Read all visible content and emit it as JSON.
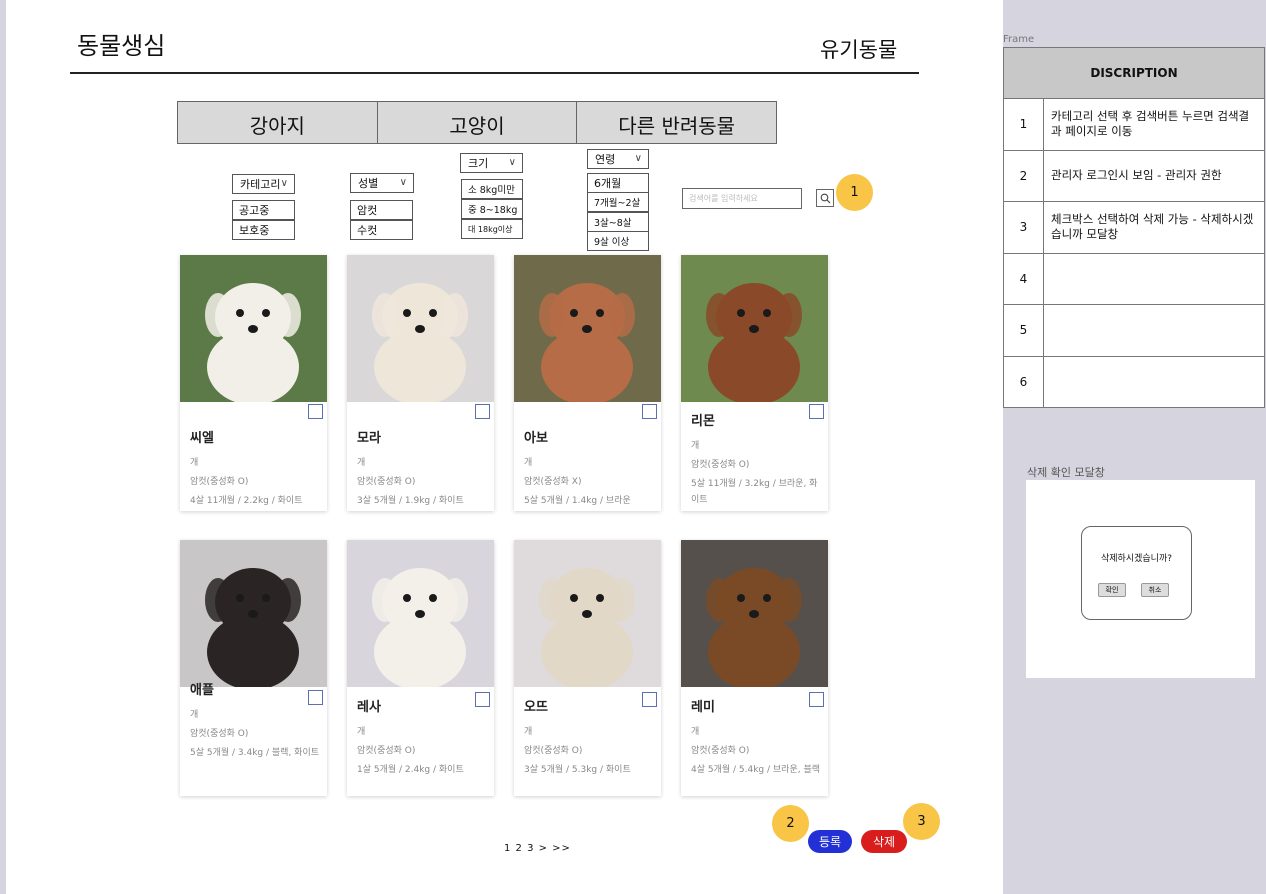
{
  "header": {
    "site_title": "동물생심",
    "page_title": "유기동물"
  },
  "tabs": [
    "강아지",
    "고양이",
    "다른 반려동물"
  ],
  "filters": {
    "category": {
      "label": "카테고리",
      "options": [
        "공고중",
        "보호중"
      ]
    },
    "sex": {
      "label": "성별",
      "options": [
        "암컷",
        "수컷"
      ]
    },
    "size": {
      "label": "크기",
      "options": [
        "소 8kg미만",
        "중 8~18kg",
        "대 18kg이상"
      ]
    },
    "age": {
      "label": "연령",
      "options": [
        "6개월",
        "7개월~2살",
        "3살~8살",
        "9살 이상"
      ]
    }
  },
  "search": {
    "placeholder": "검색어를 입력하세요"
  },
  "badges": [
    "1",
    "2",
    "3"
  ],
  "cards": [
    {
      "name": "씨엘",
      "species": "개",
      "sex": "암컷(중성화 O)",
      "detail": "4살 11개월 / 2.2kg / 화이트",
      "fur": "#f2efe8",
      "bg": "#5b7a47"
    },
    {
      "name": "모라",
      "species": "개",
      "sex": "암컷(중성화 O)",
      "detail": "3살 5개월 / 1.9kg / 화이트",
      "fur": "#efe6da",
      "bg": "#dad7d9"
    },
    {
      "name": "아보",
      "species": "개",
      "sex": "암컷(중성화 X)",
      "detail": "5살 5개월 / 1.4kg / 브라운",
      "fur": "#b56c47",
      "bg": "#6f6a4a"
    },
    {
      "name": "리몬",
      "species": "개",
      "sex": "암컷(중성화 O)",
      "detail": "5살 11개월 / 3.2kg / 브라운, 화이트",
      "fur": "#8a4a2a",
      "bg": "#6e8a4e"
    },
    {
      "name": "애플",
      "species": "개",
      "sex": "암컷(중성화 O)",
      "detail": "5살 5개월 / 3.4kg / 블랙, 화이트",
      "fur": "#2a2424",
      "bg": "#c9c6c8"
    },
    {
      "name": "레사",
      "species": "개",
      "sex": "암컷(중성화 O)",
      "detail": "1살 5개월 / 2.4kg / 화이트",
      "fur": "#f3efe9",
      "bg": "#d8d6dc"
    },
    {
      "name": "오뜨",
      "species": "개",
      "sex": "암컷(중성화 O)",
      "detail": "3살 5개월 / 5.3kg / 화이트",
      "fur": "#e2d8c8",
      "bg": "#dfdbdc"
    },
    {
      "name": "레미",
      "species": "개",
      "sex": "암컷(중성화 O)",
      "detail": "4살 5개월 / 5.4kg / 브라운, 블랙",
      "fur": "#7a4a26",
      "bg": "#55504c"
    }
  ],
  "pager": {
    "text": "1 2 3 > >>"
  },
  "actions": {
    "register": "등록",
    "delete": "삭제"
  },
  "description": {
    "frame_label": "Frame",
    "header": "DISCRIPTION",
    "rows": [
      {
        "num": "1",
        "text": "카테고리 선택 후 검색버튼 누르면 검색결과 페이지로 이동"
      },
      {
        "num": "2",
        "text": "관리자 로그인시 보임 - 관리자 권한"
      },
      {
        "num": "3",
        "text": "체크박스 선택하여 삭제 가능 - 삭제하시겠습니까 모달창"
      },
      {
        "num": "4",
        "text": ""
      },
      {
        "num": "5",
        "text": ""
      },
      {
        "num": "6",
        "text": ""
      }
    ]
  },
  "modal": {
    "label": "삭제 확인 모달창",
    "message": "삭제하시겠습니까?",
    "confirm": "확인",
    "cancel": "취소"
  }
}
